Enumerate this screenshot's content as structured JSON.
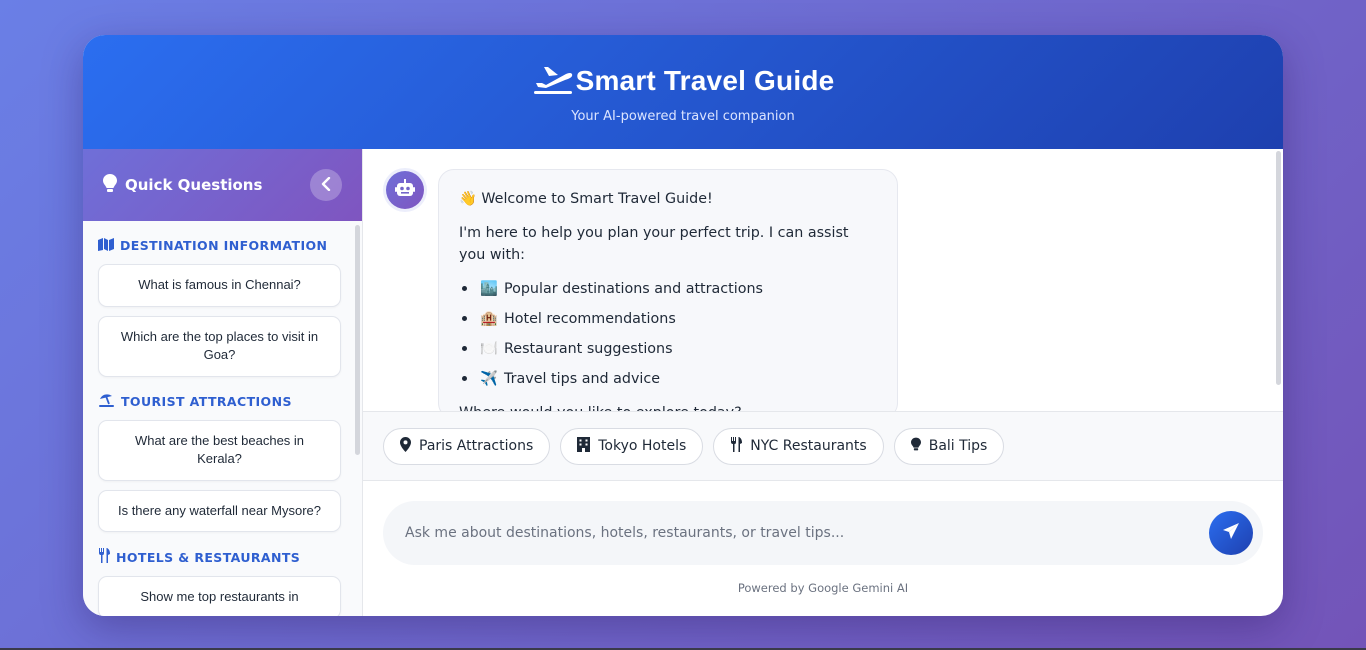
{
  "header": {
    "title": "Smart Travel Guide",
    "subtitle": "Your AI-powered travel companion"
  },
  "sidebar": {
    "title": "Quick Questions",
    "categories": [
      {
        "label": "DESTINATION INFORMATION",
        "icon": "map-icon",
        "questions": [
          "What is famous in Chennai?",
          "Which are the top places to visit in Goa?"
        ]
      },
      {
        "label": "TOURIST ATTRACTIONS",
        "icon": "umbrella-beach-icon",
        "questions": [
          "What are the best beaches in Kerala?",
          "Is there any waterfall near Mysore?"
        ]
      },
      {
        "label": "HOTELS & RESTAURANTS",
        "icon": "utensils-icon",
        "questions": [
          "Show me top restaurants in"
        ]
      }
    ]
  },
  "chat": {
    "welcome": "👋 Welcome to Smart Travel Guide!",
    "intro": "I'm here to help you plan your perfect trip. I can assist you with:",
    "items": [
      {
        "emoji": "🏙️",
        "text": "Popular destinations and attractions"
      },
      {
        "emoji": "🏨",
        "text": "Hotel recommendations"
      },
      {
        "emoji": "🍽️",
        "text": "Restaurant suggestions"
      },
      {
        "emoji": "✈️",
        "text": "Travel tips and advice"
      }
    ],
    "closing": "Where would you like to explore today?"
  },
  "quick_actions": [
    {
      "label": "Paris Attractions",
      "icon": "map-pin-icon"
    },
    {
      "label": "Tokyo Hotels",
      "icon": "building-icon"
    },
    {
      "label": "NYC Restaurants",
      "icon": "utensils-icon"
    },
    {
      "label": "Bali Tips",
      "icon": "lightbulb-icon"
    }
  ],
  "input": {
    "placeholder": "Ask me about destinations, hotels, restaurants, or travel tips...",
    "value": ""
  },
  "footer": {
    "powered_by": "Powered by Google Gemini AI"
  },
  "colors": {
    "accent_blue": "#2b6ef0",
    "accent_purple": "#7f55c0",
    "category_blue": "#2f5fd0"
  }
}
